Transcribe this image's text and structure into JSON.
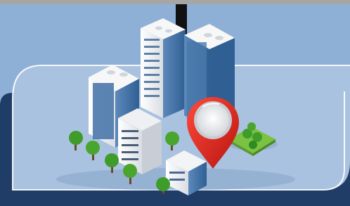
{
  "scene": {
    "description_visible_text": "",
    "colors": {
      "sky": "#8fb0d6",
      "panel_dark": "#1f3d66",
      "panel_light": "#a9c2df",
      "top_bar": "#a6a6a6",
      "pin_red": "#d8241b",
      "tree_green": "#3f9b2a",
      "grass_green": "#7cc242",
      "building_glass": "#3f6fa2",
      "building_wall": "#f1f2f4"
    },
    "icons": [
      "city-buildings-illustration",
      "location-pin-icon",
      "tree-icon",
      "grass-patch"
    ]
  }
}
